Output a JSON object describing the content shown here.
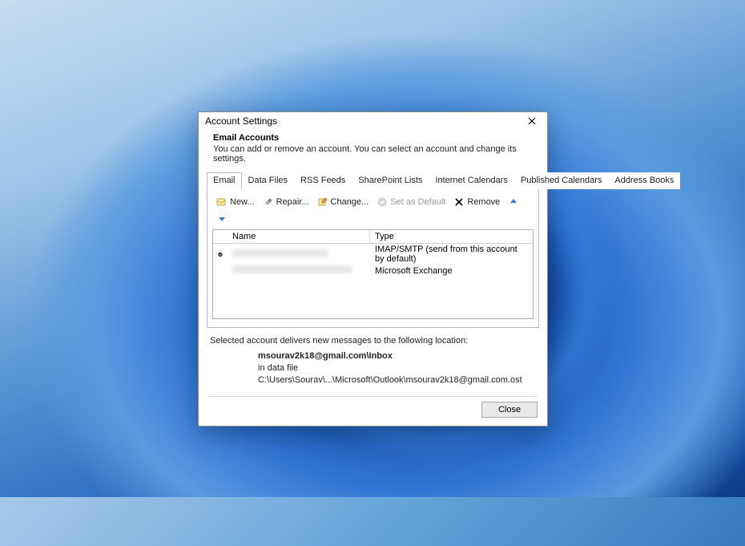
{
  "dialog": {
    "title": "Account Settings",
    "header": {
      "title": "Email Accounts",
      "description": "You can add or remove an account. You can select an account and change its settings."
    },
    "tabs": [
      {
        "label": "Email",
        "active": true
      },
      {
        "label": "Data Files",
        "active": false
      },
      {
        "label": "RSS Feeds",
        "active": false
      },
      {
        "label": "SharePoint Lists",
        "active": false
      },
      {
        "label": "Internet Calendars",
        "active": false
      },
      {
        "label": "Published Calendars",
        "active": false
      },
      {
        "label": "Address Books",
        "active": false
      }
    ],
    "toolbar": {
      "new": "New...",
      "repair": "Repair...",
      "change": "Change...",
      "set_default": "Set as Default",
      "remove": "Remove"
    },
    "list": {
      "columns": {
        "name": "Name",
        "type": "Type"
      },
      "rows": [
        {
          "name": "",
          "type": "IMAP/SMTP (send from this account by default)",
          "default": true
        },
        {
          "name": "",
          "type": "Microsoft Exchange",
          "default": false
        }
      ]
    },
    "info": {
      "intro": "Selected account delivers new messages to the following location:",
      "location_bold": "msourav2k18@gmail.com\\Inbox",
      "datafile_prefix": "in data file ",
      "datafile_path": "C:\\Users\\Sourav\\...\\Microsoft\\Outlook\\msourav2k18@gmail.com.ost"
    },
    "close_button": "Close"
  }
}
